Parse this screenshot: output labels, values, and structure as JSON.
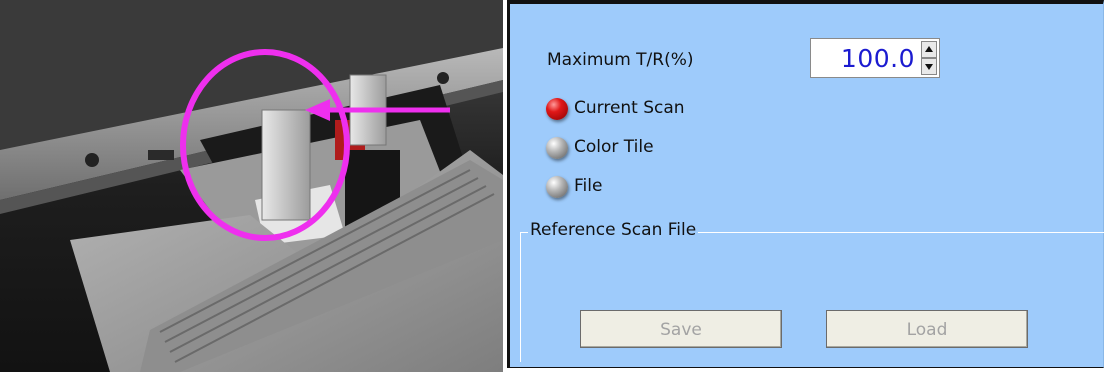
{
  "photo": {
    "subject": "cuvette holder in sample compartment",
    "highlight_color": "#ee2fee"
  },
  "form": {
    "max_tr_label": "Maximum T/R(%)",
    "max_tr_value": "100.0",
    "value_color": "#1b1bd0",
    "radios": [
      {
        "label": "Current Scan",
        "selected": true
      },
      {
        "label": "Color Tile",
        "selected": false
      },
      {
        "label": "File",
        "selected": false
      }
    ],
    "reference_group": {
      "title": "Reference Scan File",
      "save_label": "Save",
      "load_label": "Load"
    }
  },
  "colors": {
    "panel_background": "#9ecbfb",
    "selected_radio": "#e01818",
    "unselected_radio": "#9a9a9a",
    "disabled_button_text": "#a3a3a3"
  }
}
